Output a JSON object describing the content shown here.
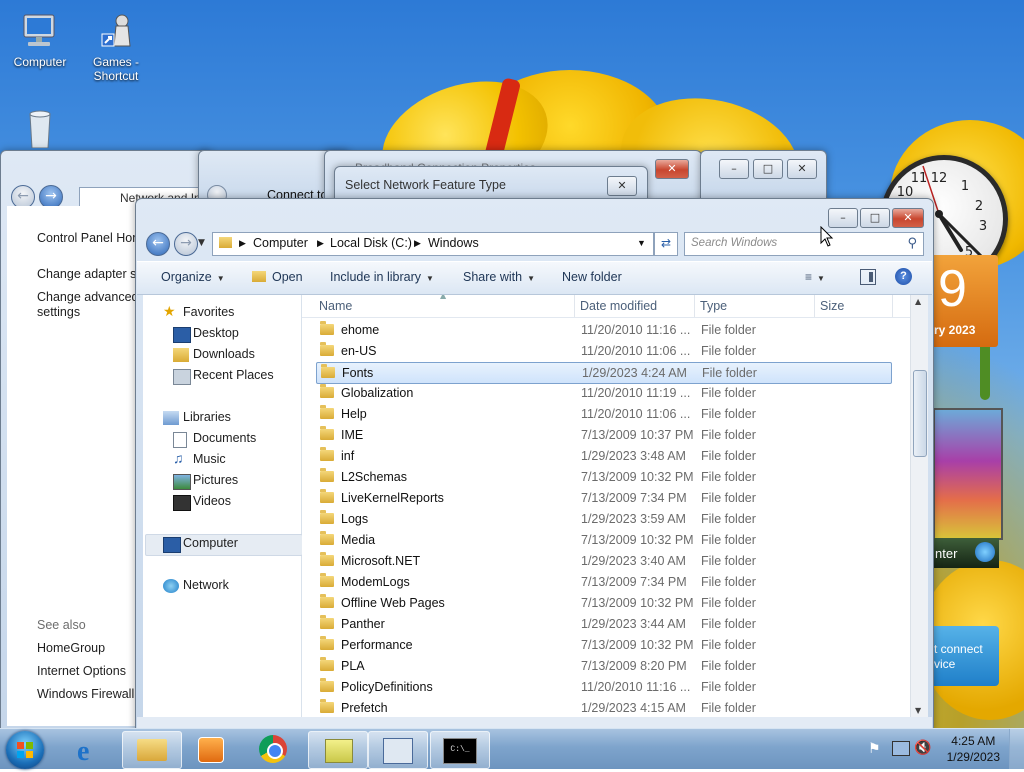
{
  "desktop": {
    "icons": [
      {
        "label": "Computer",
        "icon": "computer-icon"
      },
      {
        "label": "Games - Shortcut",
        "icon": "games-icon"
      },
      {
        "label": "",
        "icon": "recycle-bin-icon"
      }
    ]
  },
  "back_windows": {
    "control_panel": {
      "address": "Network and In",
      "links": [
        "Control Panel Hom",
        "Change adapter se",
        "Change advanced",
        "settings"
      ],
      "see_also_label": "See also",
      "see_also": [
        "HomeGroup",
        "Internet Options",
        "Windows Firewall"
      ]
    },
    "connect_to": {
      "title": "Connect to"
    },
    "dialog": {
      "title": "Select Network Feature Type",
      "title_behind": "Broadband Connection Properties"
    }
  },
  "explorer": {
    "address": {
      "segments": [
        "Computer",
        "Local Disk (C:)",
        "Windows"
      ]
    },
    "search_placeholder": "Search Windows",
    "toolbar": {
      "organize": "Organize",
      "open": "Open",
      "include": "Include in library",
      "share": "Share with",
      "new_folder": "New folder"
    },
    "nav": {
      "favorites": "Favorites",
      "desktop": "Desktop",
      "downloads": "Downloads",
      "recent": "Recent Places",
      "libraries": "Libraries",
      "documents": "Documents",
      "music": "Music",
      "pictures": "Pictures",
      "videos": "Videos",
      "computer": "Computer",
      "network": "Network"
    },
    "columns": {
      "name": "Name",
      "date": "Date modified",
      "type": "Type",
      "size": "Size"
    },
    "files": [
      {
        "name": "ehome",
        "date": "11/20/2010 11:16 ...",
        "type": "File folder"
      },
      {
        "name": "en-US",
        "date": "11/20/2010 11:06 ...",
        "type": "File folder"
      },
      {
        "name": "Fonts",
        "date": "1/29/2023 4:24 AM",
        "type": "File folder"
      },
      {
        "name": "Globalization",
        "date": "11/20/2010 11:19 ...",
        "type": "File folder"
      },
      {
        "name": "Help",
        "date": "11/20/2010 11:06 ...",
        "type": "File folder"
      },
      {
        "name": "IME",
        "date": "7/13/2009 10:37 PM",
        "type": "File folder"
      },
      {
        "name": "inf",
        "date": "1/29/2023 3:48 AM",
        "type": "File folder"
      },
      {
        "name": "L2Schemas",
        "date": "7/13/2009 10:32 PM",
        "type": "File folder"
      },
      {
        "name": "LiveKernelReports",
        "date": "7/13/2009 7:34 PM",
        "type": "File folder"
      },
      {
        "name": "Logs",
        "date": "1/29/2023 3:59 AM",
        "type": "File folder"
      },
      {
        "name": "Media",
        "date": "7/13/2009 10:32 PM",
        "type": "File folder"
      },
      {
        "name": "Microsoft.NET",
        "date": "1/29/2023 3:40 AM",
        "type": "File folder"
      },
      {
        "name": "ModemLogs",
        "date": "7/13/2009 7:34 PM",
        "type": "File folder"
      },
      {
        "name": "Offline Web Pages",
        "date": "7/13/2009 10:32 PM",
        "type": "File folder"
      },
      {
        "name": "Panther",
        "date": "1/29/2023 3:44 AM",
        "type": "File folder"
      },
      {
        "name": "Performance",
        "date": "7/13/2009 10:32 PM",
        "type": "File folder"
      },
      {
        "name": "PLA",
        "date": "7/13/2009 8:20 PM",
        "type": "File folder"
      },
      {
        "name": "PolicyDefinitions",
        "date": "11/20/2010 11:16 ...",
        "type": "File folder"
      },
      {
        "name": "Prefetch",
        "date": "1/29/2023 4:15 AM",
        "type": "File folder"
      }
    ],
    "selected_index": 2
  },
  "gadgets": {
    "calendar_day": "9",
    "calendar_month": "ry 2023",
    "media_center": "nter",
    "connect_text": "t connect\nvice"
  },
  "taskbar": {
    "time": "4:25 AM",
    "date": "1/29/2023",
    "cmd_label": "C:\\_"
  },
  "colors": {
    "selection": "#cfe3fb",
    "link_blue": "#1a3e8d",
    "taskbar": "#7ea4cc"
  }
}
